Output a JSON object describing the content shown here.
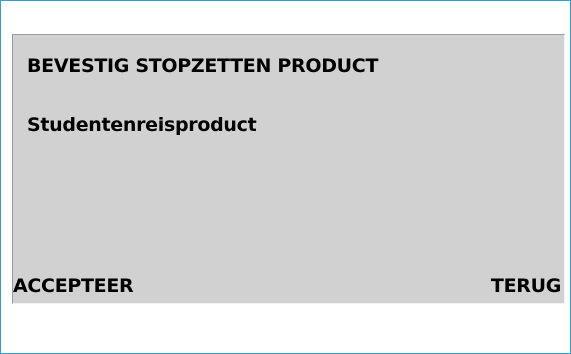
{
  "dialog": {
    "title": "BEVESTIG STOPZETTEN PRODUCT",
    "product_name": "Studentenreisproduct"
  },
  "softkeys": {
    "accept_label": "ACCEPTEER",
    "back_label": "TERUG"
  },
  "colors": {
    "frame_border": "#2f9fd0",
    "panel_background": "#d1d1d1",
    "text": "#000000"
  }
}
